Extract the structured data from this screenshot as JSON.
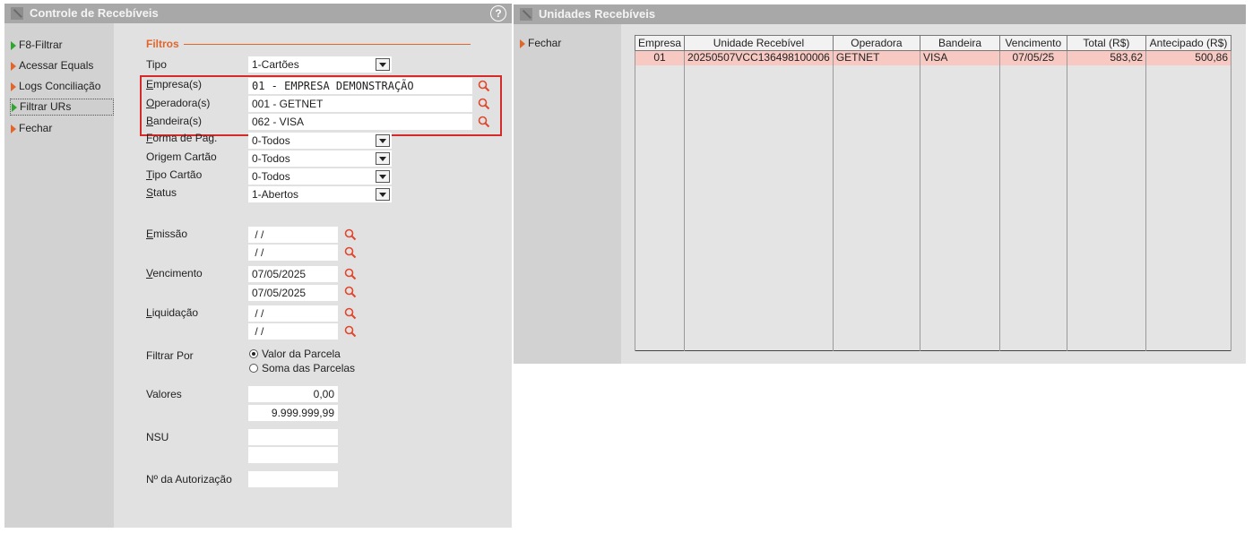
{
  "left_window": {
    "title": "Controle de Recebíveis",
    "help": "?",
    "sidebar": [
      {
        "label": "F8-Filtrar",
        "arrow": "green"
      },
      {
        "label": "Acessar Equals",
        "arrow": "orange"
      },
      {
        "label": "Logs Conciliação",
        "arrow": "orange"
      },
      {
        "label": "Filtrar URs",
        "arrow": "green",
        "selected": true
      },
      {
        "label": "Fechar",
        "arrow": "orange"
      }
    ],
    "filters_heading": "Filtros",
    "fields": {
      "tipo": {
        "label": "Tipo",
        "value": "1-Cartões"
      },
      "empresa": {
        "label": "Empresa(s)",
        "value": "01 - EMPRESA DEMONSTRAÇÃO"
      },
      "operadora": {
        "label": "Operadora(s)",
        "value": "001 - GETNET"
      },
      "bandeira": {
        "label": "Bandeira(s)",
        "value": "062 - VISA"
      },
      "forma_pag": {
        "label": "Forma de Pag.",
        "value": "0-Todos"
      },
      "origem_cartao": {
        "label": "Origem Cartão",
        "value": "0-Todos"
      },
      "tipo_cartao": {
        "label": "Tipo Cartão",
        "value": "0-Todos"
      },
      "status": {
        "label": "Status",
        "value": "1-Abertos"
      },
      "emissao": {
        "label": "Emissão",
        "from": " / /",
        "to": " / /"
      },
      "vencimento": {
        "label": "Vencimento",
        "from": "07/05/2025",
        "to": "07/05/2025"
      },
      "liquidacao": {
        "label": "Liquidação",
        "from": " / /",
        "to": " / /"
      },
      "filtrar_por": {
        "label": "Filtrar Por",
        "opt1": "Valor da Parcela",
        "opt2": "Soma das Parcelas",
        "selected": 1
      },
      "valores": {
        "label": "Valores",
        "from": "0,00",
        "to": "9.999.999,99"
      },
      "nsu": {
        "label": "NSU",
        "from": "",
        "to": ""
      },
      "autorizacao": {
        "label": "Nº da Autorização",
        "value": ""
      }
    },
    "accent_color": "#e0662c",
    "highlight_box_color": "#d32a2a"
  },
  "right_window": {
    "title": "Unidades Recebíveis",
    "sidebar": [
      {
        "label": "Fechar",
        "arrow": "orange"
      }
    ],
    "columns": [
      "Empresa",
      "Unidade Recebível",
      "Operadora",
      "Bandeira",
      "Vencimento",
      "Total (R$)",
      "Antecipado (R$)"
    ],
    "rows": [
      [
        "01",
        "20250507VCC136498100006",
        "GETNET",
        "VISA",
        "07/05/25",
        "583,62",
        "500,86"
      ]
    ]
  }
}
